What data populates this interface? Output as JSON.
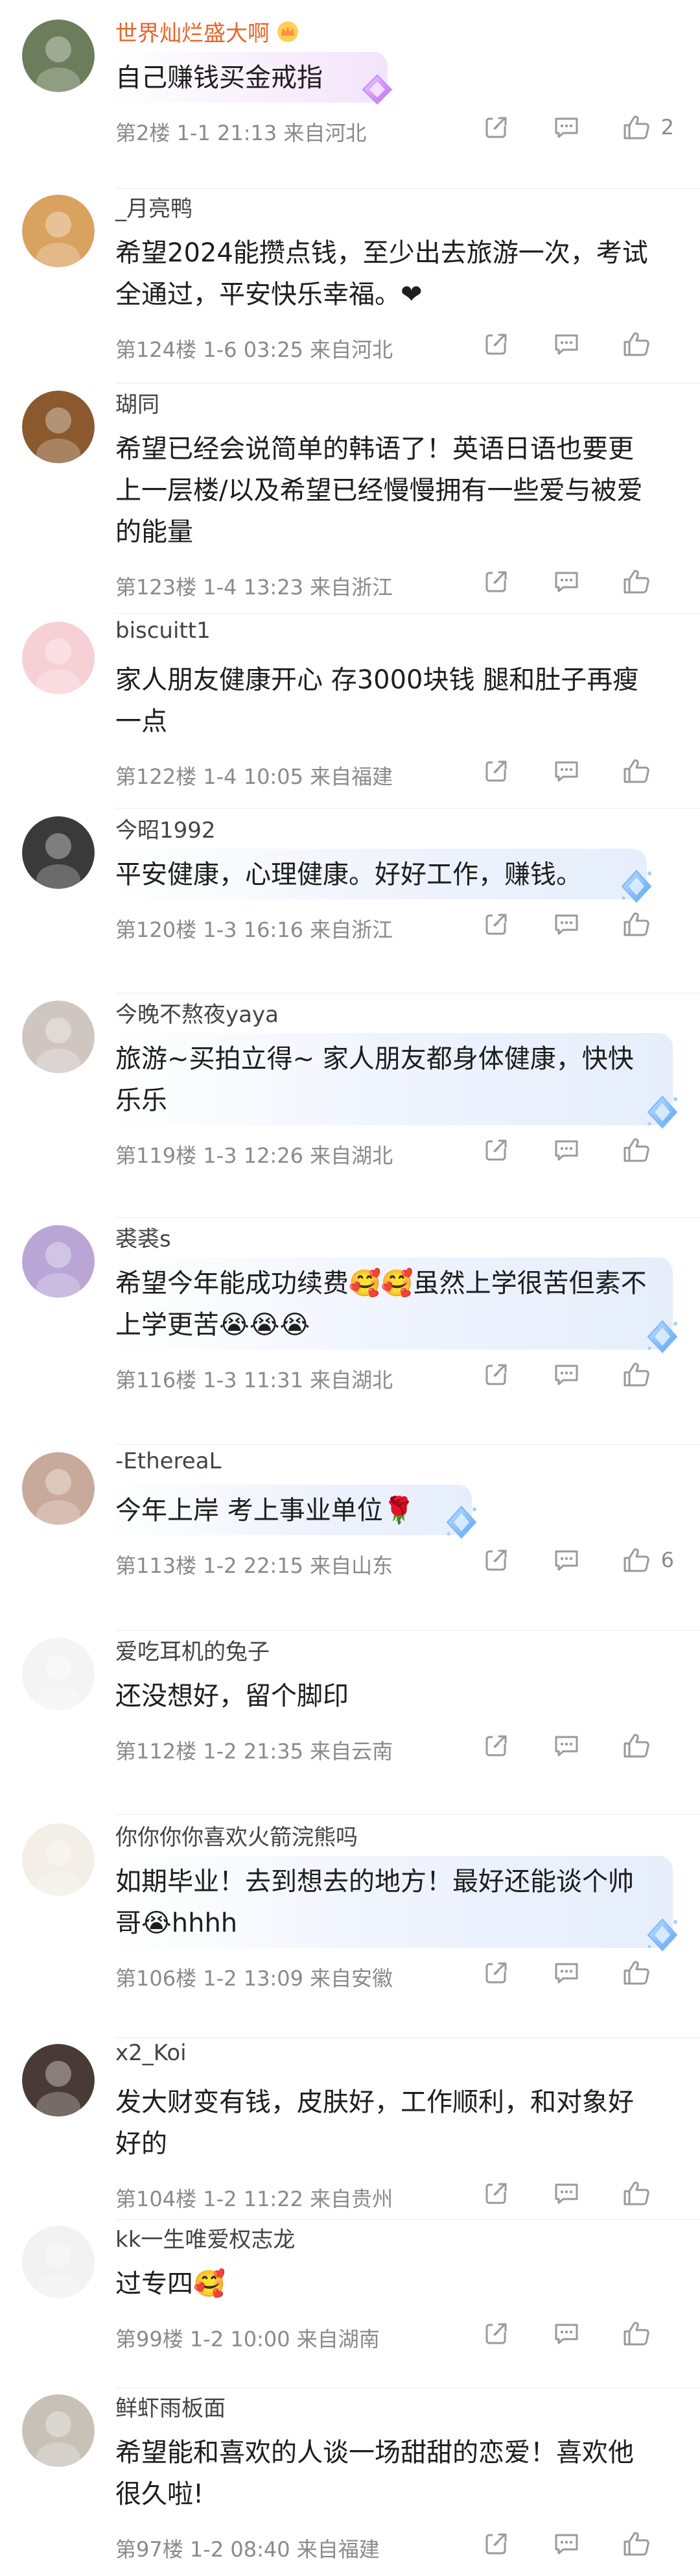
{
  "comments": [
    {
      "username": "世界灿烂盛大啊",
      "username_highlight": true,
      "has_badge": true,
      "text": "自己赚钱买金戒指",
      "floor": "第2楼",
      "date": "1-1 21:13",
      "location": "来自河北",
      "likes": "2",
      "bubble": "pink",
      "avatar_color": "#6b7d5a"
    },
    {
      "username": "_月亮鸭",
      "text": "希望2024能攒点钱，至少出去旅游一次，考试全通过，平安快乐幸福。❤",
      "floor": "第124楼",
      "date": "1-6 03:25",
      "location": "来自河北",
      "likes": "",
      "bubble": "none",
      "avatar_color": "#d9a25f"
    },
    {
      "username": "瑚同",
      "text": "希望已经会说简单的韩语了！英语日语也要更上一层楼/以及希望已经慢慢拥有一些爱与被爱的能量",
      "floor": "第123楼",
      "date": "1-4 13:23",
      "location": "来自浙江",
      "likes": "",
      "bubble": "none",
      "avatar_color": "#8a5a2e"
    },
    {
      "username": "biscuitt1",
      "text": "家人朋友健康开心 存3000块钱 腿和肚子再瘦一点",
      "floor": "第122楼",
      "date": "1-4 10:05",
      "location": "来自福建",
      "likes": "",
      "bubble": "none",
      "avatar_color": "#f7d0d6"
    },
    {
      "username": "今昭1992",
      "text": "平安健康，心理健康。好好工作，赚钱。",
      "floor": "第120楼",
      "date": "1-3 16:16",
      "location": "来自浙江",
      "likes": "",
      "bubble": "blue",
      "avatar_color": "#3a3a3a"
    },
    {
      "username": "今晚不熬夜yaya",
      "text": "旅游~买拍立得~ 家人朋友都身体健康，快快乐乐",
      "floor": "第119楼",
      "date": "1-3 12:26",
      "location": "来自湖北",
      "likes": "",
      "bubble": "blue",
      "avatar_color": "#cfc6c0"
    },
    {
      "username": "裘裘s",
      "text": "希望今年能成功续费🥰🥰虽然上学很苦但素不上学更苦😭😭😭",
      "floor": "第116楼",
      "date": "1-3 11:31",
      "location": "来自湖北",
      "likes": "",
      "bubble": "blue",
      "avatar_color": "#b9a6d6"
    },
    {
      "username": "-EthereaL",
      "text": "今年上岸 考上事业单位🌹",
      "floor": "第113楼",
      "date": "1-2 22:15",
      "location": "来自山东",
      "likes": "6",
      "bubble": "blue",
      "avatar_color": "#c9a99a"
    },
    {
      "username": "爱吃耳机的兔子",
      "text": "还没想好，留个脚印",
      "floor": "第112楼",
      "date": "1-2 21:35",
      "location": "来自云南",
      "likes": "",
      "bubble": "none",
      "avatar_color": "#f4f4f4"
    },
    {
      "username": "你你你你喜欢火箭浣熊吗",
      "text": "如期毕业！去到想去的地方！最好还能谈个帅哥😭hhhh",
      "floor": "第106楼",
      "date": "1-2 13:09",
      "location": "来自安徽",
      "likes": "",
      "bubble": "blue",
      "avatar_color": "#f3efe6"
    },
    {
      "username": "x2_Koi",
      "text": "发大财变有钱，皮肤好，工作顺利，和对象好好的",
      "floor": "第104楼",
      "date": "1-2 11:22",
      "location": "来自贵州",
      "likes": "",
      "bubble": "none",
      "avatar_color": "#4a3a35"
    },
    {
      "username": "kk一生唯爱权志龙",
      "text": "过专四🥰",
      "floor": "第99楼",
      "date": "1-2 10:00",
      "location": "来自湖南",
      "likes": "",
      "bubble": "none",
      "avatar_color": "#f2f2f2"
    },
    {
      "username": "鲜虾雨板面",
      "text": "希望能和喜欢的人谈一场甜甜的恋爱！喜欢他很久啦!",
      "floor": "第97楼",
      "date": "1-2 08:40",
      "location": "来自福建",
      "likes": "",
      "bubble": "none",
      "avatar_color": "#c7c1b7"
    }
  ],
  "colors": {
    "highlight_username": "#e8662b",
    "meta": "#8a8a8a",
    "divider": "#ececec"
  },
  "icons": [
    "share-icon",
    "comment-icon",
    "thumbs-up-icon",
    "diamond-gem-icon",
    "crown-badge-icon"
  ]
}
